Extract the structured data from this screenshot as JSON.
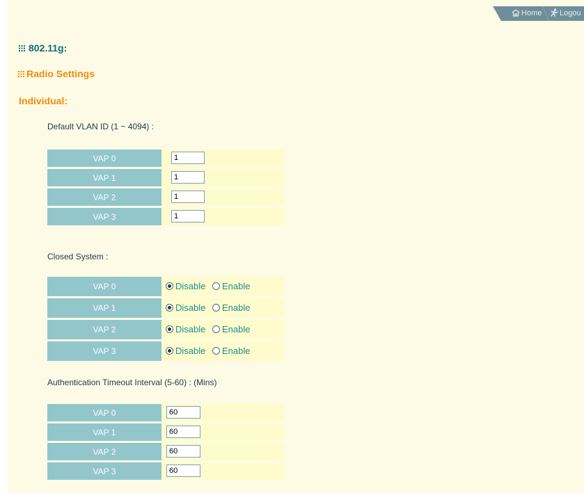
{
  "nav": {
    "home_label": "Home",
    "logout_label": "Logou"
  },
  "headings": {
    "band": "802.11g:",
    "section": "Radio Settings",
    "group": "Individual:"
  },
  "vlan": {
    "label": "Default VLAN ID (1 ~ 4094) :",
    "rows": [
      {
        "name": "VAP 0",
        "value": "1"
      },
      {
        "name": "VAP 1",
        "value": "1"
      },
      {
        "name": "VAP 2",
        "value": "1"
      },
      {
        "name": "VAP 3",
        "value": "1"
      }
    ]
  },
  "closed_system": {
    "label": "Closed System :",
    "option_disable": "Disable",
    "option_enable": "Enable",
    "rows": [
      {
        "name": "VAP 0",
        "selected": "Disable"
      },
      {
        "name": "VAP 1",
        "selected": "Disable"
      },
      {
        "name": "VAP 2",
        "selected": "Disable"
      },
      {
        "name": "VAP 3",
        "selected": "Disable"
      }
    ]
  },
  "auth_timeout": {
    "label": "Authentication Timeout Interval (5-60) : (Mins)",
    "rows": [
      {
        "name": "VAP 0",
        "value": "60"
      },
      {
        "name": "VAP 1",
        "value": "60"
      },
      {
        "name": "VAP 2",
        "value": "60"
      },
      {
        "name": "VAP 3",
        "value": "60"
      }
    ]
  },
  "colors": {
    "page_bg": "#fdfbe6",
    "label_cell": "#92c6cb",
    "value_cell": "#fefccc",
    "heading_teal": "#0e6c79",
    "heading_orange": "#f08c0a",
    "nav_tab": "#6f8e9b"
  },
  "icons": {
    "home": "home-icon",
    "logout": "running-man-icon",
    "bullet": "grid-bullet-icon"
  }
}
